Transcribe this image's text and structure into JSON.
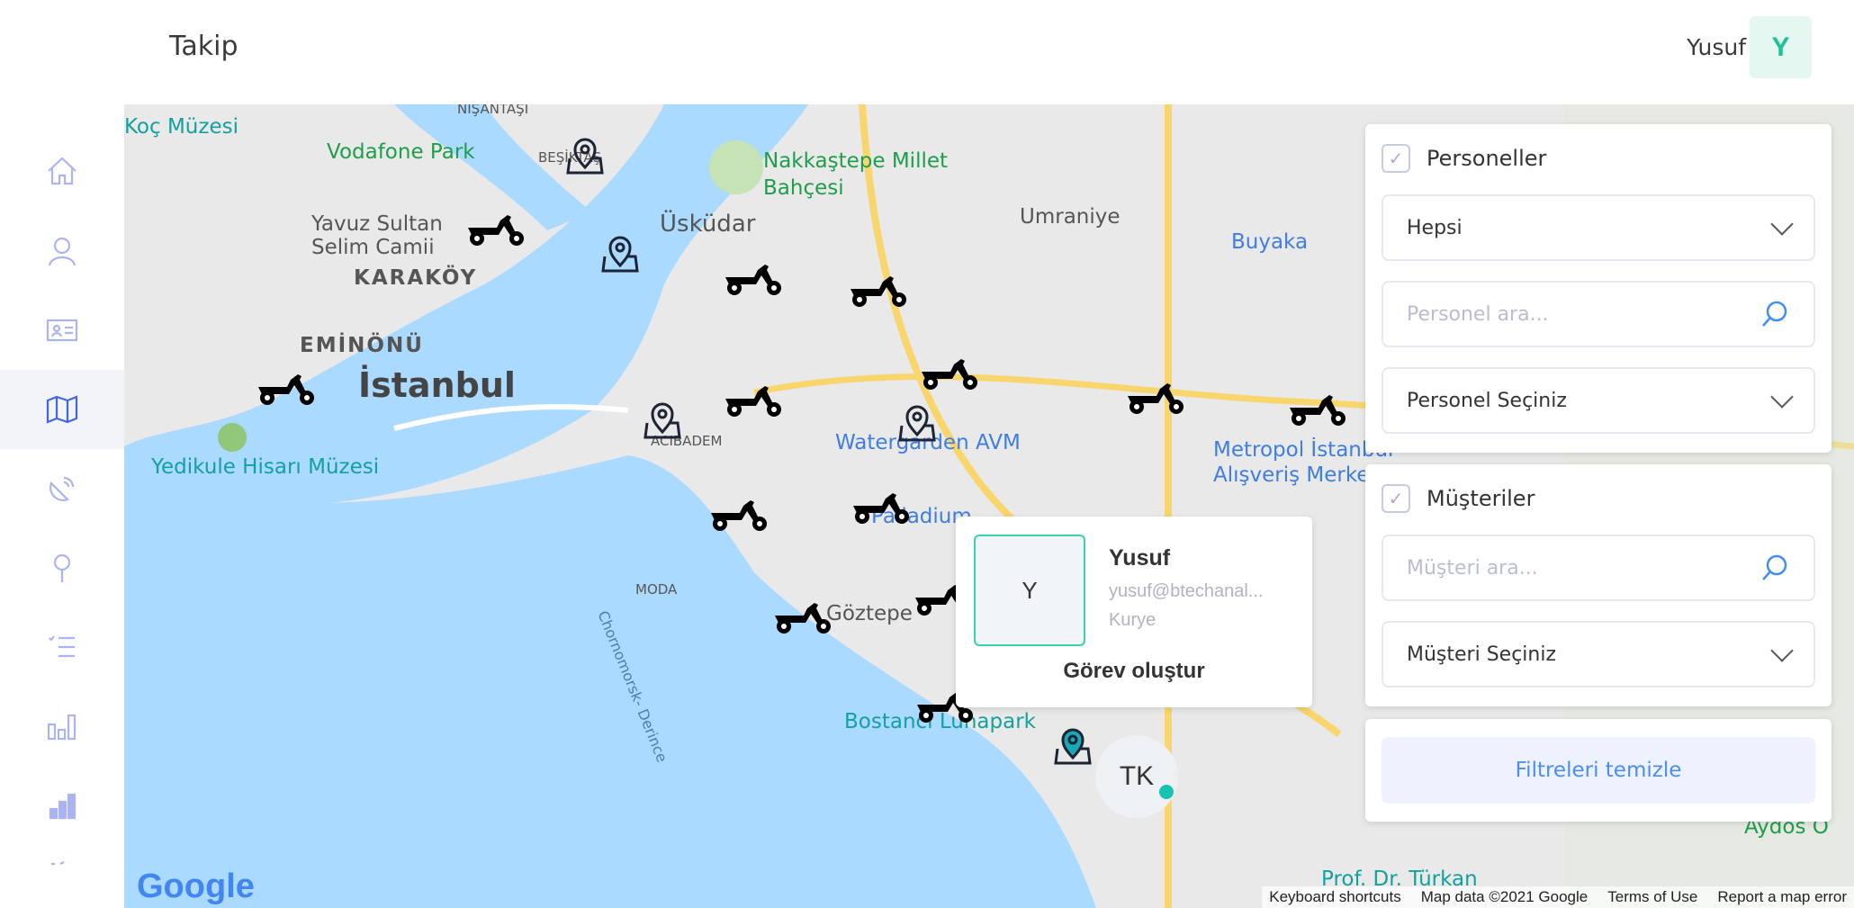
{
  "header": {
    "title": "Takip",
    "user_name": "Yusuf",
    "avatar_initial": "Y"
  },
  "sidebar": {
    "items": [
      {
        "icon": "home-icon"
      },
      {
        "icon": "user-icon"
      },
      {
        "icon": "id-card-icon"
      },
      {
        "icon": "map-icon",
        "active": true
      },
      {
        "icon": "satellite-icon"
      },
      {
        "icon": "location-pin-icon"
      },
      {
        "icon": "checklist-icon"
      },
      {
        "icon": "bar-chart-icon"
      },
      {
        "icon": "stats-icon"
      },
      {
        "icon": "more-icon"
      }
    ]
  },
  "map": {
    "labels": [
      "Koç Müzesi",
      "Vodafone Park",
      "NİŞANTAŞI",
      "BEŞİKTAŞ",
      "Yavuz Sultan Selim Camii",
      "KARAKÖY",
      "EMİNÖNÜ",
      "İstanbul",
      "Yedikule Hisarı Müzesi",
      "Üsküdar",
      "Nakkaştepe Millet Bahçesi",
      "Umraniye",
      "Buyaka",
      "Metropol İstanbul Alışveriş Merkezi",
      "Watergarden AVM",
      "ACIBADEM",
      "Palladium",
      "MODA",
      "Göztepe",
      "Bostancı Lunapark",
      "Prof. Dr. Türkan",
      "Aydos O",
      "Chornomorsk- Derince"
    ],
    "cluster_label": "TK",
    "google_logo": "Google",
    "footer": {
      "shortcuts": "Keyboard shortcuts",
      "map_data": "Map data ©2021 Google",
      "terms": "Terms of Use",
      "report": "Report a map error"
    }
  },
  "popup": {
    "avatar_initial": "Y",
    "name": "Yusuf",
    "email": "yusuf@btechanal...",
    "role": "Kurye",
    "action": "Görev oluştur"
  },
  "filters": {
    "personnel": {
      "label": "Personeller",
      "checked": true,
      "type_value": "Hepsi",
      "search_placeholder": "Personel ara...",
      "select_placeholder": "Personel Seçiniz"
    },
    "customers": {
      "label": "Müşteriler",
      "checked": true,
      "search_placeholder": "Müşteri ara...",
      "select_placeholder": "Müşteri Seçiniz"
    },
    "clear_label": "Filtreleri temizle"
  },
  "colors": {
    "accent": "#3f66e8",
    "teal": "#1ac29a",
    "water": "#aadaff"
  }
}
